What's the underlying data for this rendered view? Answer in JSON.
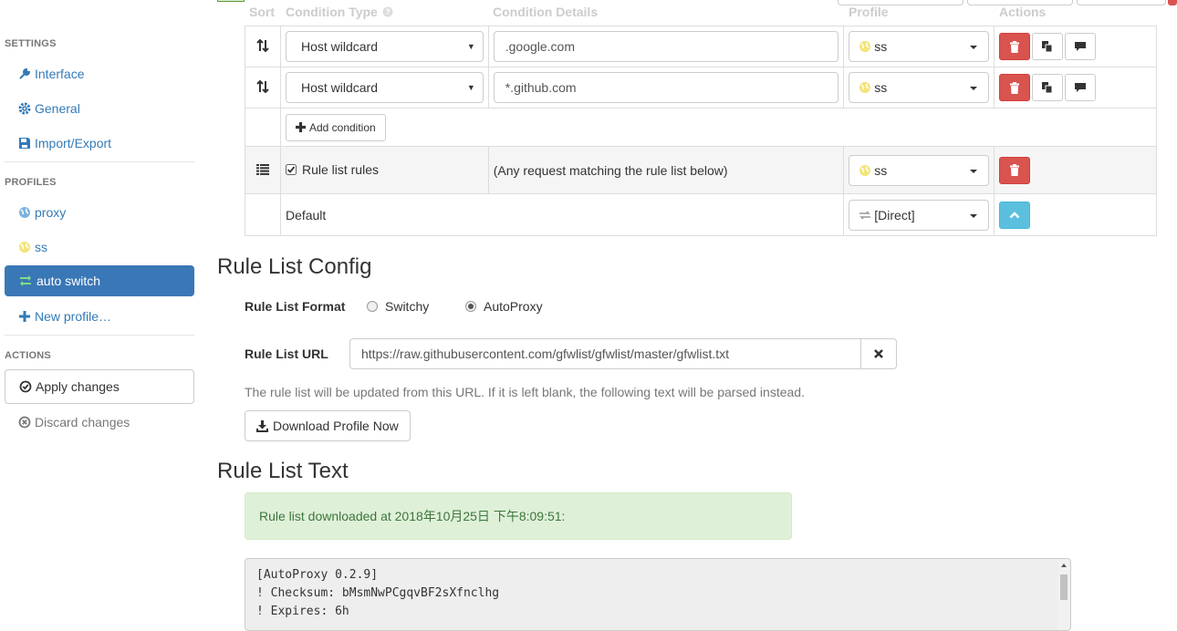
{
  "sidebar": {
    "settings_header": "SETTINGS",
    "settings_items": [
      {
        "label": "Interface",
        "icon": "wrench-icon"
      },
      {
        "label": "General",
        "icon": "gear-icon"
      },
      {
        "label": "Import/Export",
        "icon": "floppy-icon"
      }
    ],
    "profiles_header": "PROFILES",
    "profile_items": [
      {
        "label": "proxy",
        "icon": "globe-icon"
      },
      {
        "label": "ss",
        "icon": "globe-icon"
      },
      {
        "label": "auto switch",
        "icon": "retweet-icon"
      },
      {
        "label": "New profile…",
        "icon": "plus-icon"
      }
    ],
    "actions_header": "ACTIONS",
    "apply_label": "Apply changes",
    "discard_label": "Discard changes"
  },
  "table": {
    "headers": {
      "sort": "Sort",
      "condition_type": "Condition Type",
      "condition_details": "Condition Details",
      "profile": "Profile",
      "actions": "Actions"
    },
    "rows": [
      {
        "type": "Host wildcard",
        "details": ".google.com",
        "profile": "ss"
      },
      {
        "type": "Host wildcard",
        "details": "*.github.com",
        "profile": "ss"
      }
    ],
    "add_condition_label": "Add condition",
    "rule_list_row": {
      "label": "Rule list rules",
      "details": "(Any request matching the rule list below)",
      "profile": "ss"
    },
    "default_row": {
      "label": "Default",
      "profile": "[Direct]"
    }
  },
  "rule_list_config": {
    "title": "Rule List Config",
    "format_label": "Rule List Format",
    "format_options": [
      "Switchy",
      "AutoProxy"
    ],
    "format_selected": "AutoProxy",
    "url_label": "Rule List URL",
    "url_value": "https://raw.githubusercontent.com/gfwlist/gfwlist/master/gfwlist.txt",
    "help_text": "The rule list will be updated from this URL. If it is left blank, the following text will be parsed instead.",
    "download_label": "Download Profile Now"
  },
  "rule_list_text": {
    "title": "Rule List Text",
    "alert": "Rule list downloaded at 2018年10月25日 下午8:09:51:",
    "lines": [
      "[AutoProxy 0.2.9]",
      "! Checksum: bMsmNwPCgqvBF2sXfnclhg",
      "! Expires: 6h"
    ]
  },
  "colors": {
    "accent": "#337ab7",
    "active_bg": "#3a77b6",
    "danger": "#d9534f",
    "info": "#5bc0de",
    "success_bg": "#dff0d8"
  }
}
